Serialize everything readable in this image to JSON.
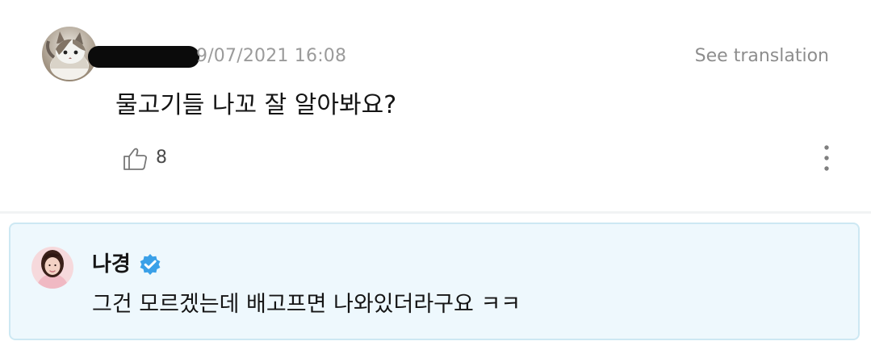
{
  "comment": {
    "timestamp": "9/07/2021 16:08",
    "translate_label": "See translation",
    "text": "물고기들 나꼬 잘 알아봐요?",
    "likes": "8",
    "avatar_icon": "cat-avatar",
    "username_redacted": true
  },
  "reply": {
    "name": "나경",
    "verified_icon": "verified-badge",
    "text": "그건 모르겠는데 배고프면 나와있더라구요 ㅋㅋ",
    "avatar_icon": "artist-avatar",
    "accent_color": "#3aa0e8",
    "background_color": "#eef8fd"
  },
  "icons": {
    "like": "thumbs-up-outline",
    "more": "vertical-dots"
  }
}
